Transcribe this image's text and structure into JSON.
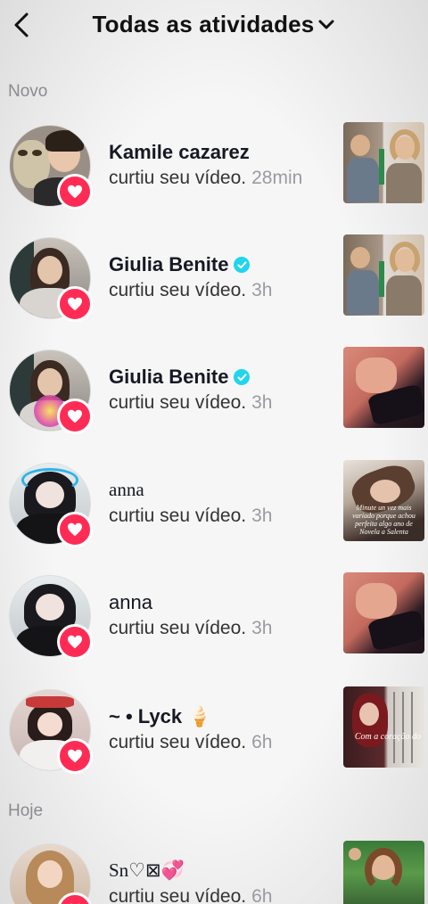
{
  "header": {
    "title": "Todas as atividades",
    "back_icon": "chevron-left-icon",
    "dropdown_icon": "chevron-down-icon"
  },
  "sections": {
    "new_label": "Novo",
    "today_label": "Hoje"
  },
  "colors": {
    "heart_badge": "#fe2c55",
    "verified": "#20d5ec",
    "time_text": "#9a9ba1"
  },
  "activities": [
    {
      "name": "Kamile cazarez",
      "verified": false,
      "action": "curtiu seu vídeo.",
      "time": "28min"
    },
    {
      "name": "Giulia Benite",
      "verified": true,
      "action": "curtiu seu vídeo.",
      "time": "3h"
    },
    {
      "name": "Giulia Benite",
      "verified": true,
      "action": "curtiu seu vídeo.",
      "time": "3h"
    },
    {
      "name": "anna",
      "verified": false,
      "action": "curtiu seu vídeo.",
      "time": "3h"
    },
    {
      "name": "anna",
      "verified": false,
      "action": "curtiu seu vídeo.",
      "time": "3h"
    },
    {
      "name": "~ • Lyck 🍦",
      "verified": false,
      "action": "curtiu seu vídeo.",
      "time": "6h"
    },
    {
      "name": "Sn♡⊠💞",
      "verified": false,
      "action": "curtiu seu vídeo.",
      "time": "6h"
    }
  ],
  "thumb_captions": {
    "row4": "Minute un vez mais variado porque achou perfeita algo ano de Novela a Salenta",
    "row6": "Com a coração do"
  }
}
